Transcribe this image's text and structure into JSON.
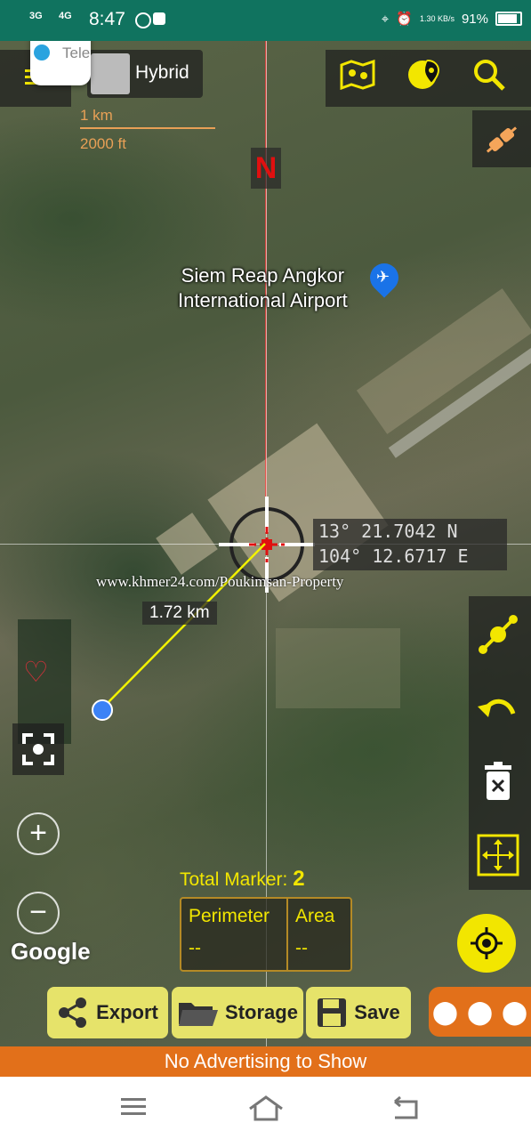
{
  "status_bar": {
    "net1": "3G",
    "net2": "4G",
    "time": "8:47",
    "speed": "1.30 KB/s",
    "battery": "91%"
  },
  "notification": {
    "label": "Tele"
  },
  "map_type": {
    "label": "Hybrid"
  },
  "scale": {
    "km": "1 km",
    "ft": "2000 ft"
  },
  "compass": {
    "label": "N"
  },
  "place": {
    "line1": "Siem Reap Angkor",
    "line2": "International Airport"
  },
  "coords": {
    "lat": "13° 21.7042 N",
    "lon": "104° 12.6717 E"
  },
  "watermark": "www.khmer24.com/Poukimsan-Property",
  "distance": "1.72 km",
  "google_logo": "Google",
  "total_marker": {
    "label": "Total Marker:",
    "value": "2"
  },
  "stats": {
    "perimeter_label": "Perimeter",
    "perimeter_value": "--",
    "area_label": "Area",
    "area_value": "--"
  },
  "toolbar": {
    "export": "Export",
    "storage": "Storage",
    "save": "Save"
  },
  "ad": "No Advertising to Show",
  "colors": {
    "accent": "#e6e36a",
    "status_bar": "#10735f",
    "ad_bar": "#e2701a",
    "icon_yellow": "#f2e600"
  }
}
